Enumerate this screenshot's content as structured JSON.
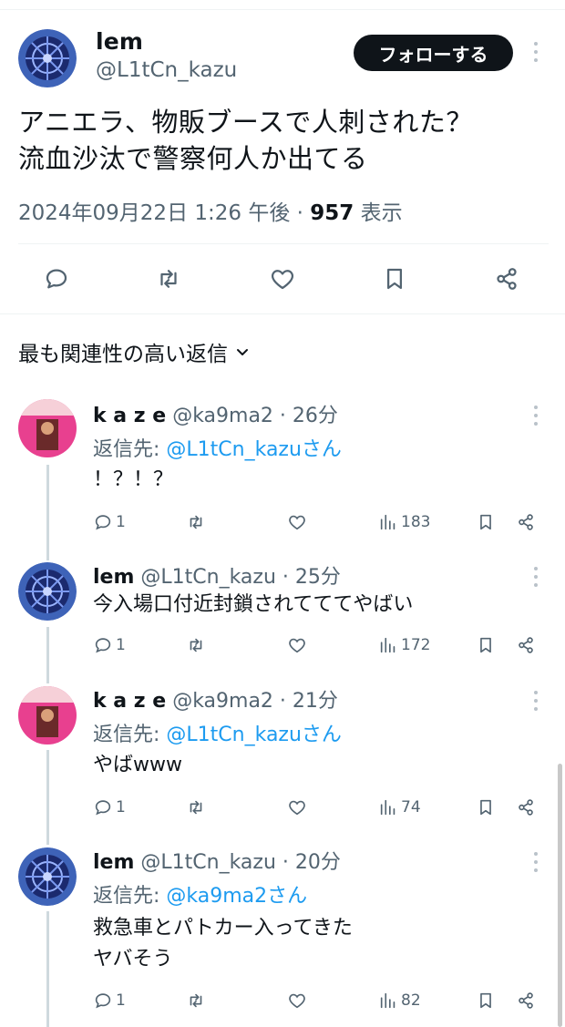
{
  "main_post": {
    "user_name": "lem",
    "handle": "@L1tCn_kazu",
    "follow_label": "フォローする",
    "text": "アニエラ、物販ブースで人刺された？\n流血沙汰で警察何人か出てる",
    "datetime": "2024年09月22日 1:26 午後",
    "view_count": "957",
    "view_label": "表示"
  },
  "sort_label": "最も関連性の高い返信",
  "replies": [
    {
      "name": "k a z e",
      "meta": "@ka9ma2 · 26分",
      "reply_prefix": "返信先: ",
      "reply_to": "@L1tCn_kazuさん",
      "text": "！？！？",
      "replies": "1",
      "views": "183"
    },
    {
      "name": "lem",
      "meta": "@L1tCn_kazu · 25分",
      "text": "今入場口付近封鎖されてててやばい",
      "replies": "1",
      "views": "172"
    },
    {
      "name": "k a z e",
      "meta": "@ka9ma2 · 21分",
      "reply_prefix": "返信先: ",
      "reply_to": "@L1tCn_kazuさん",
      "text": "やばwww",
      "replies": "1",
      "views": "74"
    },
    {
      "name": "lem",
      "meta": "@L1tCn_kazu · 20分",
      "reply_prefix": "返信先: ",
      "reply_to": "@ka9ma2さん",
      "text": "救急車とパトカー入ってきた\nヤバそう",
      "replies": "1",
      "views": "82"
    }
  ],
  "colors": {
    "accent": "#1d9bf0",
    "text": "#0f1419",
    "muted": "#536471",
    "kaze_avatar": "#e8408f",
    "lem_avatar": "#2c3f8f"
  },
  "icons": [
    "reply-icon",
    "retweet-icon",
    "like-icon",
    "bookmark-icon",
    "share-icon",
    "views-icon",
    "more-icon",
    "chevron-down-icon"
  ]
}
